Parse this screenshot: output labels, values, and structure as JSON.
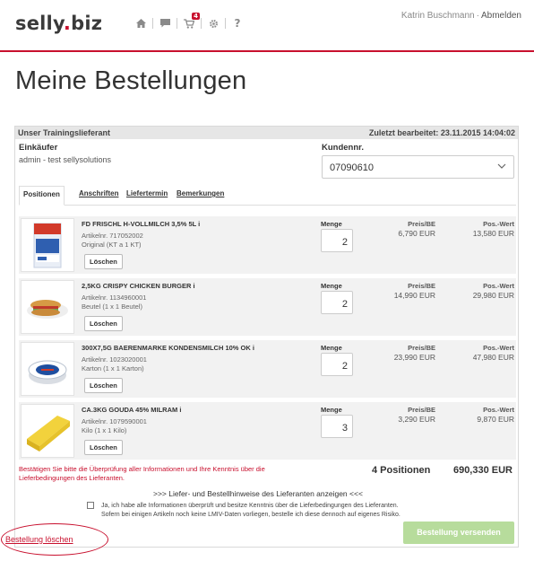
{
  "header": {
    "logo_main": "selly",
    "logo_dot": ".",
    "logo_tld": "biz",
    "nav_icons": [
      "home-icon",
      "chat-icon",
      "cart-icon",
      "gear-icon",
      "help-icon"
    ],
    "cart_badge": "4",
    "help_label": "?",
    "user_name": "Katrin Buschmann",
    "separator": "·",
    "logout_label": "Abmelden"
  },
  "page": {
    "title": "Meine Bestellungen"
  },
  "order": {
    "supplier": "Unser Trainingslieferant",
    "last_edited": "Zuletzt bearbeitet: 23.11.2015 14:04:02",
    "buyer_label": "Einkäufer",
    "buyer_value": "admin - test sellysolutions",
    "customer_no_label": "Kundennr.",
    "customer_no_value": "07090610",
    "tabs": [
      "Positionen",
      "Anschriften",
      "Liefertermin",
      "Bemerkungen"
    ],
    "items": [
      {
        "name": "FD FRISCHL H-VOLLMILCH 3,5% 5L",
        "info": "i",
        "article": "Artikelnr. 717052002",
        "unit": "Original (KT a 1 KT)",
        "delete_label": "Löschen",
        "qty_label": "Menge",
        "qty": "2",
        "price_label": "Preis/BE",
        "price": "6,790 EUR",
        "value_label": "Pos.-Wert",
        "value": "13,580 EUR"
      },
      {
        "name": "2,5KG CRISPY CHICKEN BURGER",
        "info": "i",
        "article": "Artikelnr. 1134960001",
        "unit": "Beutel (1 x 1 Beutel)",
        "delete_label": "Löschen",
        "qty_label": "Menge",
        "qty": "2",
        "price_label": "Preis/BE",
        "price": "14,990 EUR",
        "value_label": "Pos.-Wert",
        "value": "29,980 EUR"
      },
      {
        "name": "300X7,5G BAERENMARKE KONDENSMILCH 10% OK",
        "info": "i",
        "article": "Artikelnr. 1023020001",
        "unit": "Karton (1 x 1 Karton)",
        "delete_label": "Löschen",
        "qty_label": "Menge",
        "qty": "2",
        "price_label": "Preis/BE",
        "price": "23,990 EUR",
        "value_label": "Pos.-Wert",
        "value": "47,980 EUR"
      },
      {
        "name": "CA.3KG GOUDA 45% MILRAM",
        "info": "i",
        "article": "Artikelnr. 1079590001",
        "unit": "Kilo (1 x 1 Kilo)",
        "delete_label": "Löschen",
        "qty_label": "Menge",
        "qty": "3",
        "price_label": "Preis/BE",
        "price": "3,290 EUR",
        "value_label": "Pos.-Wert",
        "value": "9,870 EUR"
      }
    ],
    "confirm_notice": "Bestätigen Sie bitte die Überprüfung aller Informationen und Ihre Kenntnis über die Lieferbedingungen des Lieferanten.",
    "positions_count": "4 Positionen",
    "total": "690,330 EUR",
    "supplier_notes_link": ">>> Liefer- und Bestellhinweise des Lieferanten anzeigen <<<",
    "checkbox_text_1": "Ja, ich habe alle Informationen überprüft und besitze Kenntnis über die Lieferbedingungen des Lieferanten.",
    "checkbox_text_2": "Sofern bei einigen Artikeln noch keine LMIV-Daten vorliegen, bestelle ich diese dennoch auf eigenes Risiko.",
    "delete_order_label": "Bestellung löschen",
    "send_order_label": "Bestellung versenden"
  },
  "colors": {
    "accent": "#c8102e",
    "send_button_disabled": "#b7dc9c",
    "row_bg": "#f2f2f2"
  }
}
